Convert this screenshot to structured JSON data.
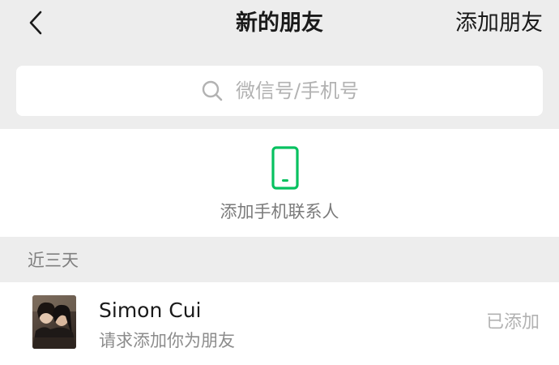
{
  "navbar": {
    "title": "新的朋友",
    "action_label": "添加朋友",
    "back_icon": "chevron-left-icon"
  },
  "search": {
    "placeholder": "微信号/手机号",
    "icon": "search-icon"
  },
  "phone_contacts": {
    "label": "添加手机联系人",
    "icon": "mobile-phone-icon",
    "icon_color": "#07c160"
  },
  "section": {
    "title": "近三天"
  },
  "requests": [
    {
      "name": "Simon Cui",
      "message": "请求添加你为朋友",
      "status": "已添加"
    }
  ],
  "colors": {
    "background": "#ededed",
    "accent": "#07c160"
  }
}
